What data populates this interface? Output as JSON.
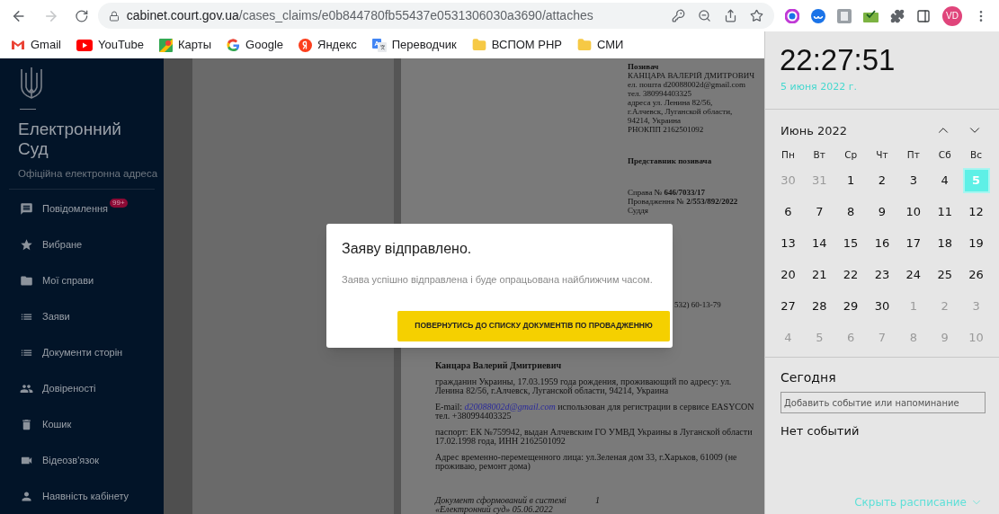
{
  "browser": {
    "url_host": "cabinet.court.gov.ua",
    "url_path": "/cases_claims/e0b844780fb55437e0531306030a3690/attaches",
    "forward_disabled": true,
    "avatar": "VD"
  },
  "bookmarks": [
    {
      "label": "Gmail",
      "kind": "gmail"
    },
    {
      "label": "YouTube",
      "kind": "youtube"
    },
    {
      "label": "Карты",
      "kind": "maps"
    },
    {
      "label": "Google",
      "kind": "google"
    },
    {
      "label": "Яндекс",
      "kind": "yandex"
    },
    {
      "label": "Переводчик",
      "kind": "translate"
    },
    {
      "label": "ВСПОМ РНР",
      "kind": "folder"
    },
    {
      "label": "СМИ",
      "kind": "folder"
    }
  ],
  "sidebar": {
    "title": "Електронний Суд",
    "subtitle": "Офіційна електронна адреса",
    "items": [
      {
        "label": "Повідомлення",
        "kind": "message",
        "badge": "99+"
      },
      {
        "label": "Вибране",
        "kind": "star"
      },
      {
        "label": "Мої справи",
        "kind": "folder"
      },
      {
        "label": "Заяви",
        "kind": "list"
      },
      {
        "label": "Документи сторін",
        "kind": "list"
      },
      {
        "label": "Довіреності",
        "kind": "people"
      },
      {
        "label": "Кошик",
        "kind": "trash"
      },
      {
        "label": "Відеозв'язок",
        "kind": "video"
      },
      {
        "label": "Наявність кабінету",
        "kind": "person"
      }
    ]
  },
  "document": {
    "header": [
      {
        "text": "Позивач",
        "bold": true
      },
      {
        "text": "КАНЦАРА ВАЛЕРІЙ ДМИТРОВИЧ",
        "bold": false
      },
      {
        "text": "ел. пошта d20088002d@gmail.com",
        "bold": false
      },
      {
        "text": "тел. 380994403325",
        "bold": false
      },
      {
        "text": "адреса ул. Ленина 82/56,",
        "bold": false
      },
      {
        "text": "г.Алчевск, Луганской области,",
        "bold": false
      },
      {
        "text": "94214, Украина",
        "bold": false
      },
      {
        "text": "РНОКПП 2162501092",
        "bold": false
      }
    ],
    "representative": "Представник позивача",
    "case": [
      "Справа № **646/7033/17**",
      "Провадження № **2/553/892/2022**",
      "Суддя"
    ],
    "phone_fragment": "532) 60-13-79",
    "plaintiff": "Канцара Валерий Дмитриевич",
    "paragraphs": [
      {
        "text": "гражданин Украины, 17.03.1959 года рождения, проживающий по адресу: ул. Ленина 82/56, г.Алчевск, Луганской области, 94214, Украина"
      },
      {
        "prefix": "E-mail:",
        "link": "d20088002d@gmail.com",
        "text": "использован для регистрации в сервисе EASYCON тел. +380994403325"
      },
      {
        "text": "паспорт: ЕК №759942, выдан Алчевским ГО УМВД Украины в Луганской области 17.02.1998 года, ИНН 2162501092"
      },
      {
        "text": "Адрес временно-перемещенного лица: ул.Зеленая дом 33, г.Харьков, 61009 (не проживаю, ремонт дома)"
      }
    ],
    "footer": "Документ сформований в системі «Електронний суд» 05.06.2022",
    "page_number": "1"
  },
  "modal": {
    "title": "Заяву відправлено.",
    "message": "Заява успішно відправлена і буде опрацьована найближчим часом.",
    "button": "ПОВЕРНУТИСЬ ДО СПИСКУ ДОКУМЕНТІВ ПО ПРОВАДЖЕННЮ"
  },
  "calendar": {
    "time": "22:27:51",
    "date": "5 июня 2022 г.",
    "month": "Июнь 2022",
    "weekdays": [
      "Пн",
      "Вт",
      "Ср",
      "Чт",
      "Пт",
      "Сб",
      "Вс"
    ],
    "days": [
      {
        "day": "30",
        "outside": true,
        "selected": false
      },
      {
        "day": "31",
        "outside": true,
        "selected": false
      },
      {
        "day": "1",
        "outside": false,
        "selected": false
      },
      {
        "day": "2",
        "outside": false,
        "selected": false
      },
      {
        "day": "3",
        "outside": false,
        "selected": false
      },
      {
        "day": "4",
        "outside": false,
        "selected": false
      },
      {
        "day": "5",
        "outside": false,
        "selected": true
      },
      {
        "day": "6",
        "outside": false,
        "selected": false
      },
      {
        "day": "7",
        "outside": false,
        "selected": false
      },
      {
        "day": "8",
        "outside": false,
        "selected": false
      },
      {
        "day": "9",
        "outside": false,
        "selected": false
      },
      {
        "day": "10",
        "outside": false,
        "selected": false
      },
      {
        "day": "11",
        "outside": false,
        "selected": false
      },
      {
        "day": "12",
        "outside": false,
        "selected": false
      },
      {
        "day": "13",
        "outside": false,
        "selected": false
      },
      {
        "day": "14",
        "outside": false,
        "selected": false
      },
      {
        "day": "15",
        "outside": false,
        "selected": false
      },
      {
        "day": "16",
        "outside": false,
        "selected": false
      },
      {
        "day": "17",
        "outside": false,
        "selected": false
      },
      {
        "day": "18",
        "outside": false,
        "selected": false
      },
      {
        "day": "19",
        "outside": false,
        "selected": false
      },
      {
        "day": "20",
        "outside": false,
        "selected": false
      },
      {
        "day": "21",
        "outside": false,
        "selected": false
      },
      {
        "day": "22",
        "outside": false,
        "selected": false
      },
      {
        "day": "23",
        "outside": false,
        "selected": false
      },
      {
        "day": "24",
        "outside": false,
        "selected": false
      },
      {
        "day": "25",
        "outside": false,
        "selected": false
      },
      {
        "day": "26",
        "outside": false,
        "selected": false
      },
      {
        "day": "27",
        "outside": false,
        "selected": false
      },
      {
        "day": "28",
        "outside": false,
        "selected": false
      },
      {
        "day": "29",
        "outside": false,
        "selected": false
      },
      {
        "day": "30",
        "outside": false,
        "selected": false
      },
      {
        "day": "1",
        "outside": true,
        "selected": false
      },
      {
        "day": "2",
        "outside": true,
        "selected": false
      },
      {
        "day": "3",
        "outside": true,
        "selected": false
      },
      {
        "day": "4",
        "outside": true,
        "selected": false
      },
      {
        "day": "5",
        "outside": true,
        "selected": false
      },
      {
        "day": "6",
        "outside": true,
        "selected": false
      },
      {
        "day": "7",
        "outside": true,
        "selected": false
      },
      {
        "day": "8",
        "outside": true,
        "selected": false
      },
      {
        "day": "9",
        "outside": true,
        "selected": false
      },
      {
        "day": "10",
        "outside": true,
        "selected": false
      }
    ],
    "today": "Сегодня",
    "event_placeholder": "Добавить событие или напоминание",
    "no_events": "Нет событий",
    "hide_link": "Скрыть расписание"
  }
}
